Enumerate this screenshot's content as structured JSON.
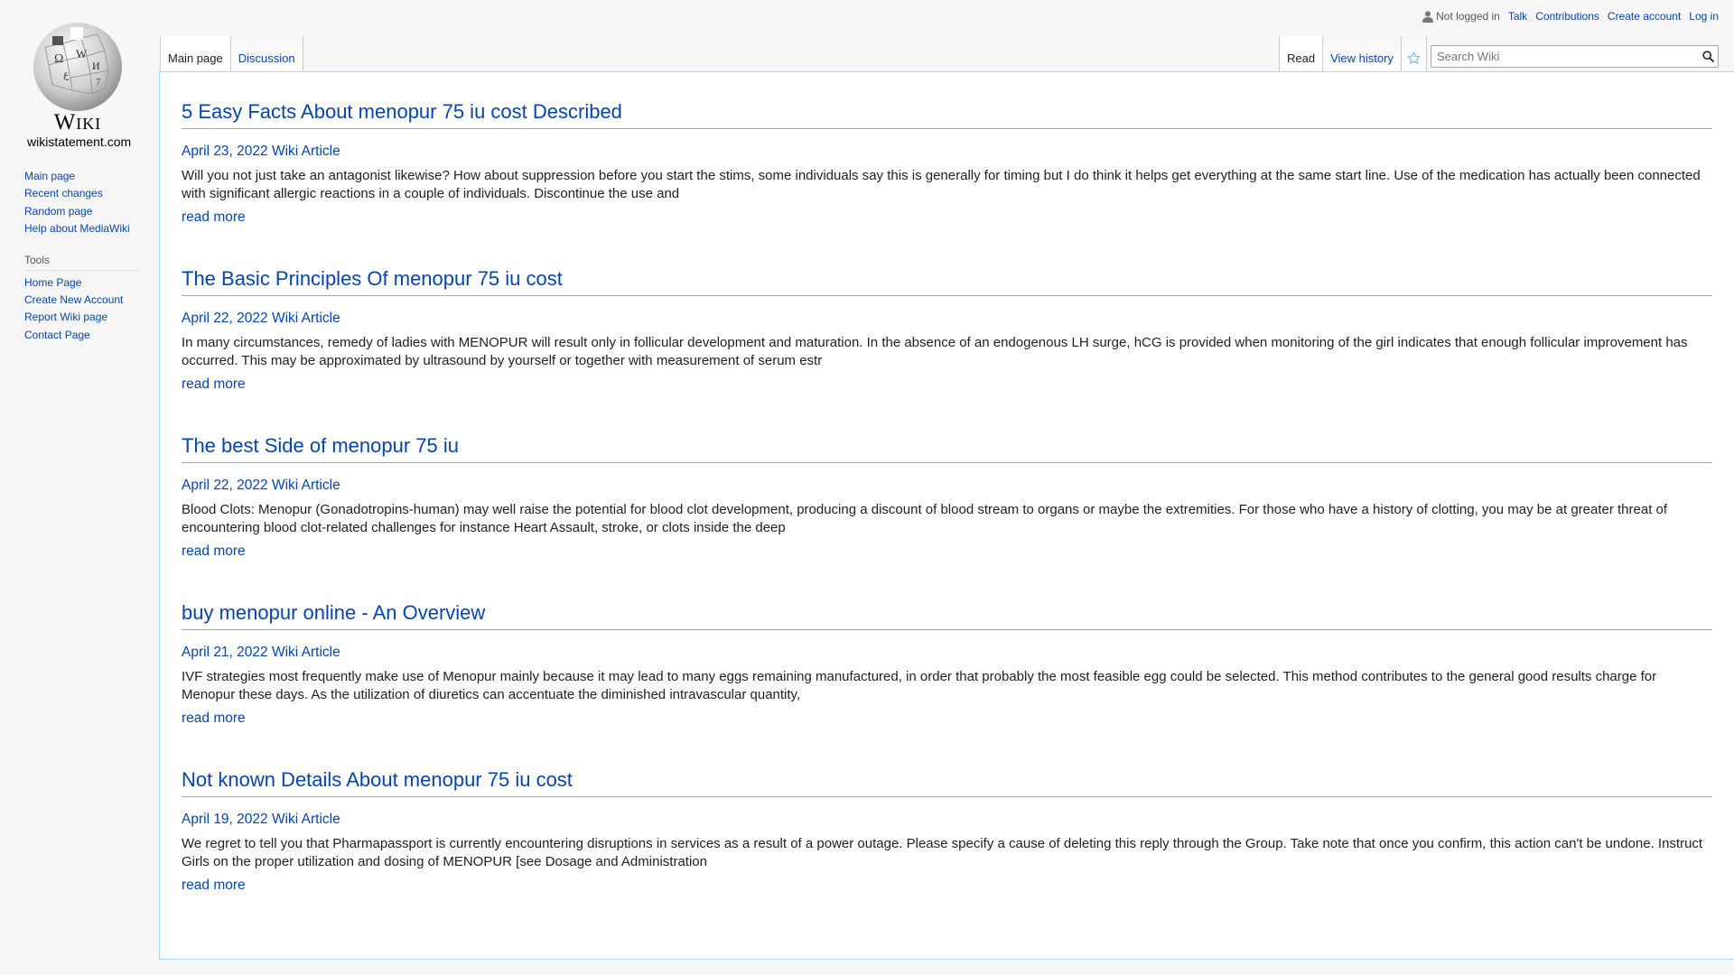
{
  "personal": {
    "status": "Not logged in",
    "links": [
      "Talk",
      "Contributions",
      "Create account",
      "Log in"
    ]
  },
  "logo": {
    "wordmark": "Wiki",
    "site": "wikistatement.com"
  },
  "sidebar": {
    "navigation": [
      "Main page",
      "Recent changes",
      "Random page",
      "Help about MediaWiki"
    ],
    "tools_heading": "Tools",
    "tools": [
      "Home Page",
      "Create New Account",
      "Report Wiki page",
      "Contact Page"
    ]
  },
  "tabs": {
    "left": [
      "Main page",
      "Discussion"
    ],
    "right": [
      "Read",
      "View history"
    ]
  },
  "search": {
    "placeholder": "Search Wiki"
  },
  "colors": {
    "link": "#0645ad",
    "border": "#a7d7f9"
  },
  "articles": [
    {
      "title": "5 Easy Facts About menopur 75 iu cost Described",
      "meta": "April 23, 2022 Wiki Article",
      "excerpt": "Will you not just take an antagonist likewise? How about suppression before you start the stims, some individuals say this is generally for timing but I do think it helps get everything at the same start line. Use of the medication has actually been connected with significant allergic reactions in a couple of individuals. Discontinue the use and",
      "readmore": "read more"
    },
    {
      "title": "The Basic Principles Of menopur 75 iu cost",
      "meta": "April 22, 2022 Wiki Article",
      "excerpt": "In many circumstances, remedy of ladies with MENOPUR will result only in follicular development and maturation. In the absence of an endogenous LH surge, hCG is provided when monitoring of the girl indicates that enough follicular improvement has occurred. This may be approximated by ultrasound by yourself or together with measurement of serum estr",
      "readmore": "read more"
    },
    {
      "title": "The best Side of menopur 75 iu",
      "meta": "April 22, 2022 Wiki Article",
      "excerpt": "Blood Clots: Menopur (Gonadotropins-human) may well raise the potential for blood clot development, producing a discount of blood stream to organs or maybe the extremities. For those who have a history of clotting, you may be at greater threat of encountering blood clot-related challenges for instance Heart Assault, stroke, or clots inside the deep",
      "readmore": "read more"
    },
    {
      "title": "buy menopur online - An Overview",
      "meta": "April 21, 2022 Wiki Article",
      "excerpt": "IVF strategies most frequently make use of Menopur mainly because it may lead to many eggs remaining manufactured, in order that probably the most feasible egg could be selected. This method contributes to the general good results charge for Menopur these days. As the utilization of diuretics can accentuate the diminished intravascular quantity,",
      "readmore": "read more"
    },
    {
      "title": "Not known Details About menopur 75 iu cost",
      "meta": "April 19, 2022 Wiki Article",
      "excerpt": "We regret to tell you that Pharmapassport is currently encountering disruptions in services as a result of a power outage. Please specify a cause of deleting this reply through the Group. Take note that once you confirm, this action can't be undone. Instruct Girls on the proper utilization and dosing of MENOPUR [see Dosage and Administration",
      "readmore": "read more"
    }
  ]
}
